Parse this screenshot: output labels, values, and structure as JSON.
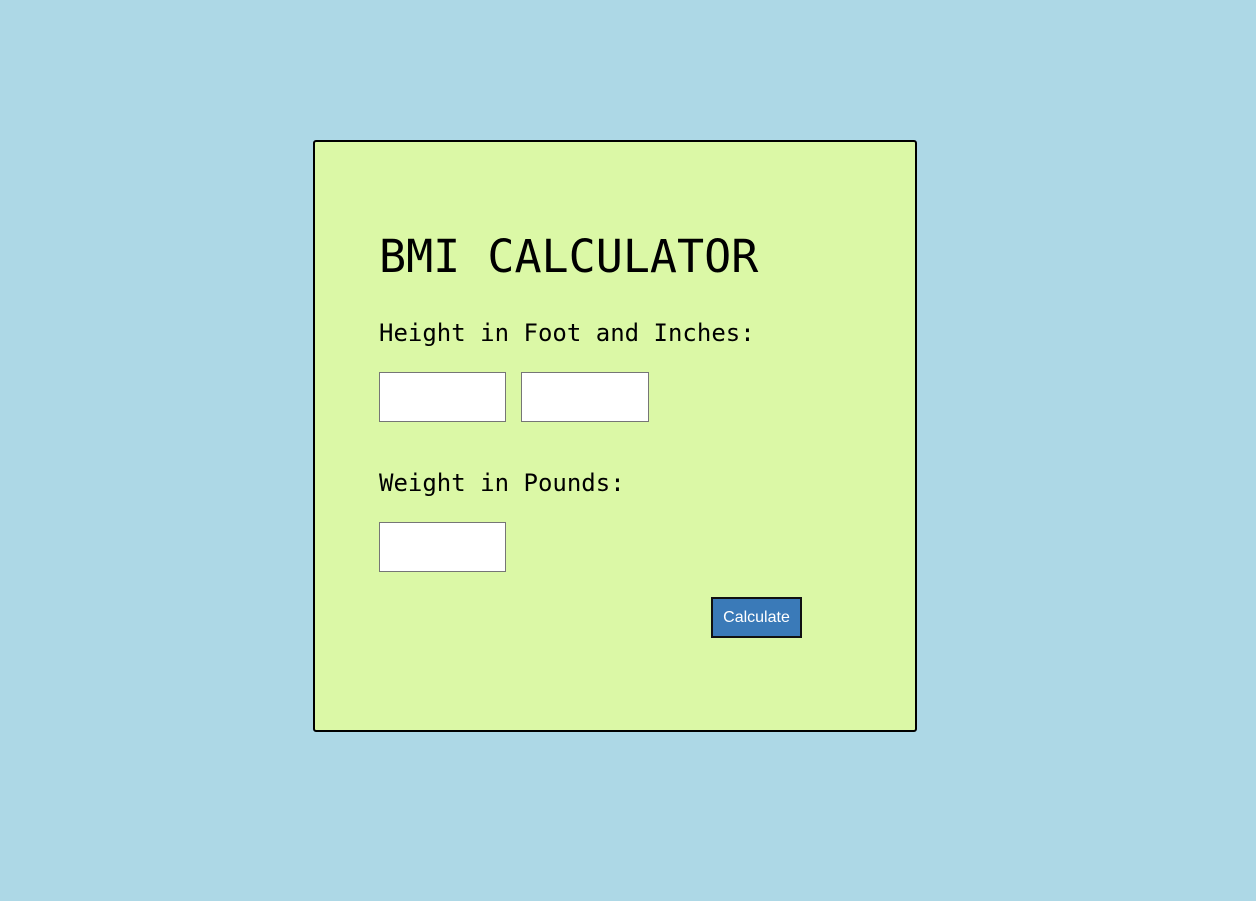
{
  "page": {
    "background_color": "#add8e6"
  },
  "card": {
    "background_color": "#dbf8a6",
    "title": "BMI CALCULATOR",
    "height_label": "Height in Foot and Inches:",
    "feet_input": {
      "value": "",
      "placeholder": ""
    },
    "inches_input": {
      "value": "",
      "placeholder": ""
    },
    "weight_label": "Weight in Pounds:",
    "pounds_input": {
      "value": "",
      "placeholder": ""
    },
    "calculate_button": {
      "label": "Calculate",
      "color": "#3a7ab8"
    }
  }
}
